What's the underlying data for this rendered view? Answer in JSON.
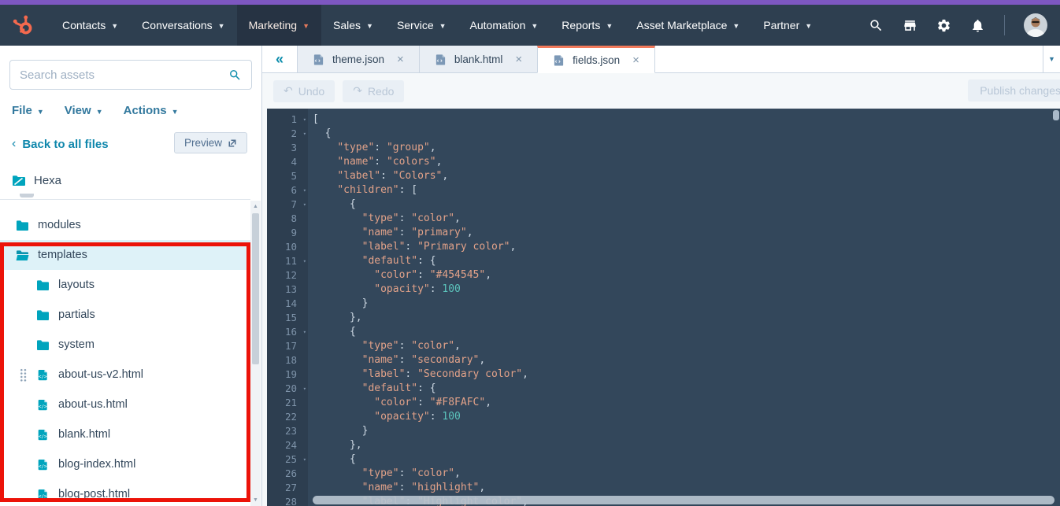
{
  "colors": {
    "purple_strip": "#7d57c1",
    "topnav_bg": "#2e3f50",
    "topnav_active_bg": "#263343",
    "brand_orange": "#f4694e",
    "active_tab_accent": "#f2795a",
    "teal_icon": "#00a4bd",
    "link_blue": "#33799e",
    "text": "#33475b",
    "editor_bg": "#33475b",
    "gutter_bg": "#2d3e50",
    "code_string": "#e2a289",
    "code_number": "#5cc5bd",
    "annotation_red": "#ec1309"
  },
  "topnav": {
    "items": [
      {
        "label": "Contacts",
        "active": false
      },
      {
        "label": "Conversations",
        "active": false
      },
      {
        "label": "Marketing",
        "active": true
      },
      {
        "label": "Sales",
        "active": false
      },
      {
        "label": "Service",
        "active": false
      },
      {
        "label": "Automation",
        "active": false
      },
      {
        "label": "Reports",
        "active": false
      },
      {
        "label": "Asset Marketplace",
        "active": false
      },
      {
        "label": "Partner",
        "active": false
      }
    ],
    "icons": [
      "search",
      "marketplace",
      "settings",
      "notifications"
    ]
  },
  "sidebar": {
    "search": {
      "placeholder": "Search assets"
    },
    "menus": [
      {
        "label": "File"
      },
      {
        "label": "View"
      },
      {
        "label": "Actions"
      }
    ],
    "back_label": "Back to all files",
    "preview_label": "Preview",
    "theme_name": "Hexa",
    "tree": [
      {
        "label": "modules",
        "icon": "folder",
        "level": 0,
        "active": false,
        "drag_handle": false
      },
      {
        "label": "templates",
        "icon": "folder-open",
        "level": 0,
        "active": true,
        "drag_handle": false
      },
      {
        "label": "layouts",
        "icon": "folder",
        "level": 1,
        "active": false,
        "drag_handle": false
      },
      {
        "label": "partials",
        "icon": "folder",
        "level": 1,
        "active": false,
        "drag_handle": false
      },
      {
        "label": "system",
        "icon": "folder",
        "level": 1,
        "active": false,
        "drag_handle": false
      },
      {
        "label": "about-us-v2.html",
        "icon": "file",
        "level": 1,
        "active": false,
        "drag_handle": true
      },
      {
        "label": "about-us.html",
        "icon": "file",
        "level": 1,
        "active": false,
        "drag_handle": false
      },
      {
        "label": "blank.html",
        "icon": "file",
        "level": 1,
        "active": false,
        "drag_handle": false
      },
      {
        "label": "blog-index.html",
        "icon": "file",
        "level": 1,
        "active": false,
        "drag_handle": false
      },
      {
        "label": "blog-post.html",
        "icon": "file",
        "level": 1,
        "active": false,
        "drag_handle": false
      }
    ]
  },
  "workspace": {
    "tabs": [
      {
        "label": "theme.json",
        "active": false
      },
      {
        "label": "blank.html",
        "active": false
      },
      {
        "label": "fields.json",
        "active": true
      }
    ],
    "toolbar": {
      "undo_label": "Undo",
      "redo_label": "Redo",
      "publish_label": "Publish changes"
    },
    "editor": {
      "fold_lines": [
        1,
        2,
        6,
        7,
        11,
        16,
        20,
        25
      ],
      "lines": [
        "[",
        "  {",
        "    \"type\": \"group\",",
        "    \"name\": \"colors\",",
        "    \"label\": \"Colors\",",
        "    \"children\": [",
        "      {",
        "        \"type\": \"color\",",
        "        \"name\": \"primary\",",
        "        \"label\": \"Primary color\",",
        "        \"default\": {",
        "          \"color\": \"#454545\",",
        "          \"opacity\": 100",
        "        }",
        "      },",
        "      {",
        "        \"type\": \"color\",",
        "        \"name\": \"secondary\",",
        "        \"label\": \"Secondary color\",",
        "        \"default\": {",
        "          \"color\": \"#F8FAFC\",",
        "          \"opacity\": 100",
        "        }",
        "      },",
        "      {",
        "        \"type\": \"color\",",
        "        \"name\": \"highlight\",",
        "        \"label\": \"Highlight color\","
      ]
    }
  }
}
